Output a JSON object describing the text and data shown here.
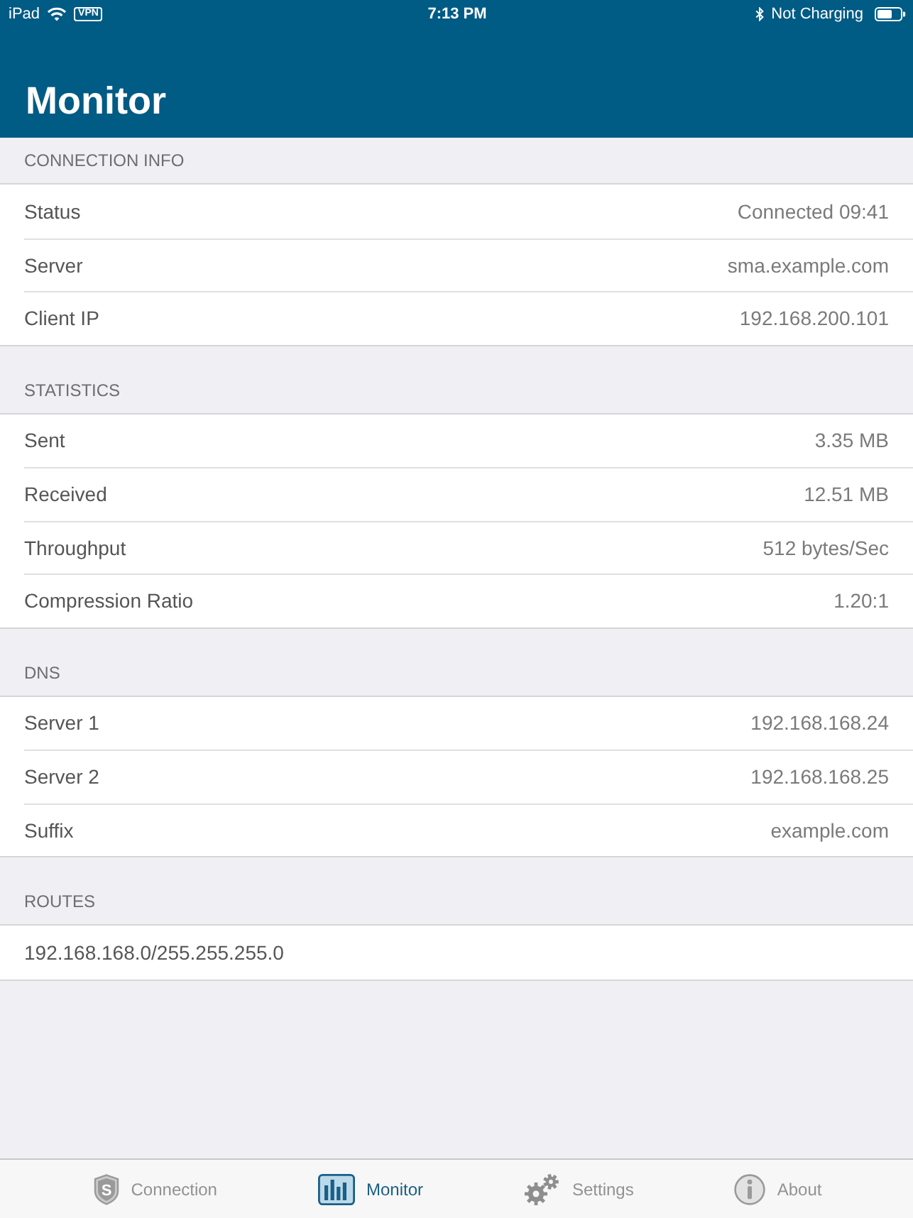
{
  "status_bar": {
    "device": "iPad",
    "vpn": "VPN",
    "time": "7:13 PM",
    "charging": "Not Charging"
  },
  "nav": {
    "title": "Monitor"
  },
  "sections": [
    {
      "title": "CONNECTION INFO",
      "rows": [
        {
          "label": "Status",
          "value": "Connected 09:41"
        },
        {
          "label": "Server",
          "value": "sma.example.com"
        },
        {
          "label": "Client IP",
          "value": "192.168.200.101"
        }
      ]
    },
    {
      "title": "STATISTICS",
      "rows": [
        {
          "label": "Sent",
          "value": "3.35 MB"
        },
        {
          "label": "Received",
          "value": "12.51 MB"
        },
        {
          "label": "Throughput",
          "value": "512 bytes/Sec"
        },
        {
          "label": "Compression Ratio",
          "value": "1.20:1"
        }
      ]
    },
    {
      "title": "DNS",
      "rows": [
        {
          "label": "Server 1",
          "value": "192.168.168.24"
        },
        {
          "label": "Server 2",
          "value": "192.168.168.25"
        },
        {
          "label": "Suffix",
          "value": "example.com"
        }
      ]
    },
    {
      "title": "ROUTES",
      "rows": [
        {
          "label": "192.168.168.0/255.255.255.0"
        }
      ]
    }
  ],
  "tab_bar": {
    "tabs": [
      {
        "label": "Connection",
        "icon_letter": "S",
        "selected": false
      },
      {
        "label": "Monitor",
        "selected": true
      },
      {
        "label": "Settings",
        "selected": false
      },
      {
        "label": "About",
        "selected": false
      }
    ]
  }
}
